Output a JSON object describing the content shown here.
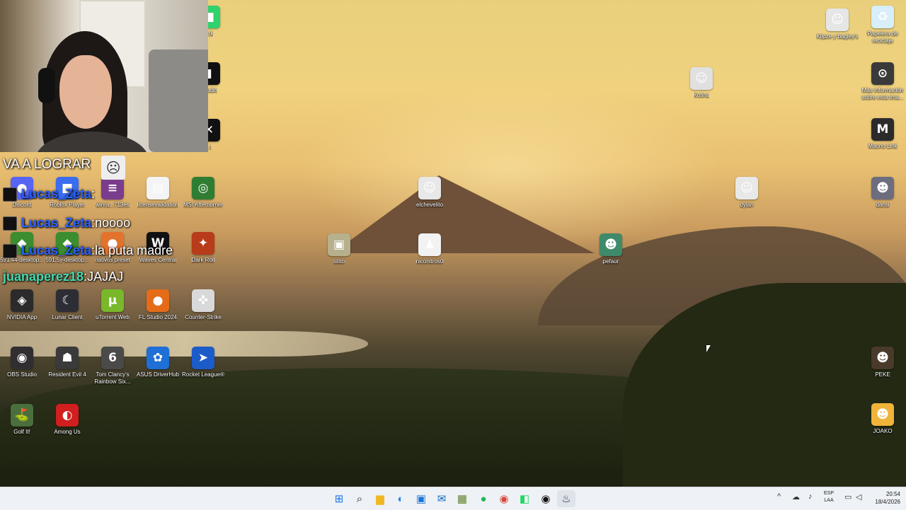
{
  "desktop": {
    "icons": [
      {
        "label": "Discord",
        "glyph": "●",
        "color": "#5865f2"
      },
      {
        "label": "Roblox Player",
        "glyph": "■",
        "color": "#3c6df0"
      },
      {
        "label": "winra...713es",
        "glyph": "≡",
        "color": "#7a3c8c"
      },
      {
        "label": "licensevalidation",
        "glyph": "▤",
        "color": "#f4f4f4"
      },
      {
        "label": "MSI Afterburner",
        "glyph": "◎",
        "color": "#2e7d32"
      },
      {
        "label": "591.44-desktop...",
        "glyph": "◆",
        "color": "#3b8d2f"
      },
      {
        "label": "591.5y-desktop...",
        "glyph": "◆",
        "color": "#3b8d2f"
      },
      {
        "label": "nativos preset",
        "glyph": "●",
        "color": "#e3732c"
      },
      {
        "label": "Waves Central",
        "glyph": "W",
        "color": "#111111"
      },
      {
        "label": "Dark Roll",
        "glyph": "✦",
        "color": "#b83b1a"
      },
      {
        "label": "NVIDIA App",
        "glyph": "◈",
        "color": "#2b2b2b"
      },
      {
        "label": "Lunar Client",
        "glyph": "☾",
        "color": "#2d2d35"
      },
      {
        "label": "uTorrent Web",
        "glyph": "µ",
        "color": "#78b82a"
      },
      {
        "label": "FL Studio 2024",
        "glyph": "●",
        "color": "#e46c19"
      },
      {
        "label": "Counter-Strike",
        "glyph": "✜",
        "color": "#d9d9d9"
      },
      {
        "label": "OBS Studio",
        "glyph": "◉",
        "color": "#302e31"
      },
      {
        "label": "Resident Evil 4",
        "glyph": "☗",
        "color": "#3a3a3a"
      },
      {
        "label": "Tom Clancy's Rainbow Six...",
        "glyph": "6",
        "color": "#4a4a4a"
      },
      {
        "label": "ASUS DriverHub",
        "glyph": "✿",
        "color": "#1e6fd6"
      },
      {
        "label": "Rocket League®",
        "glyph": "➤",
        "color": "#1c5cc9"
      },
      {
        "label": "Golf It!",
        "glyph": "⛳",
        "color": "#4a6f3c"
      },
      {
        "label": "Among Us",
        "glyph": "◐",
        "color": "#d11e1e"
      },
      {
        "label": "elchevelito",
        "glyph": "☺",
        "color": "#e8e8e8"
      },
      {
        "label": "silito",
        "glyph": "▣",
        "color": "#b7b08d"
      },
      {
        "label": "niconitros0",
        "glyph": "♟",
        "color": "#f2f2f2"
      },
      {
        "label": "pefaur",
        "glyph": "☻",
        "color": "#3f8a6a"
      },
      {
        "label": "Kotina",
        "glyph": "☺",
        "color": "#e0e0e0"
      },
      {
        "label": "dylan",
        "glyph": "☺",
        "color": "#e8e8e8"
      },
      {
        "label": "Klipze y bagley's",
        "glyph": "☺",
        "color": "#e6e6e6"
      },
      {
        "label": "Papelera de reciclaje",
        "glyph": "♻",
        "color": "#d8eef8"
      },
      {
        "label": "Más información sobre esta ima...",
        "glyph": "⊙",
        "color": "#3a3a3a"
      },
      {
        "label": "Maono Link",
        "glyph": "M",
        "color": "#2b2b2b"
      },
      {
        "label": "dansi",
        "glyph": "☻",
        "color": "#6d6d80"
      },
      {
        "label": "PEKE",
        "glyph": "☻",
        "color": "#4a3a2a"
      },
      {
        "label": "JOAKO",
        "glyph": "☻",
        "color": "#f0b43a"
      },
      {
        "label": "...tk",
        "glyph": "■",
        "color": "#2fd26c"
      },
      {
        "label": "...tudio",
        "glyph": "▮",
        "color": "#111111"
      },
      {
        "label": "...t",
        "glyph": "✕",
        "color": "#111111"
      }
    ]
  },
  "overlay": {
    "banner": "VA A LOGRAR",
    "chat": [
      {
        "user": "Lucas_Zeta",
        "sep": ": ",
        "message": "",
        "style": "user1"
      },
      {
        "user": "Lucas_Zeta",
        "sep": ": ",
        "message": "noooo",
        "style": "user1"
      },
      {
        "user": "Lucas_Zeta",
        "sep": ": ",
        "message": "la puta madre",
        "style": "user1"
      },
      {
        "user": "juanaperez18",
        "sep": ": ",
        "message": "JAJAJ",
        "style": "user2"
      }
    ]
  },
  "taskbar": {
    "apps": [
      {
        "name": "start-button",
        "glyph": "⊞",
        "color": "#1a73e8"
      },
      {
        "name": "search-button",
        "glyph": "⌕",
        "color": "#222222"
      },
      {
        "name": "file-explorer",
        "glyph": "▆",
        "color": "#f1b722"
      },
      {
        "name": "edge-browser",
        "glyph": "◐",
        "color": "#1e88e5"
      },
      {
        "name": "microsoft-store",
        "glyph": "▣",
        "color": "#1b74d8"
      },
      {
        "name": "outlook-app",
        "glyph": "✉",
        "color": "#0f6cbd"
      },
      {
        "name": "app-green",
        "glyph": "▦",
        "color": "#5f7f2a"
      },
      {
        "name": "spotify-app",
        "glyph": "●",
        "color": "#1db954"
      },
      {
        "name": "chrome-browser",
        "glyph": "◉",
        "color": "#db4437"
      },
      {
        "name": "app-green-2",
        "glyph": "◧",
        "color": "#1ed760"
      },
      {
        "name": "app-record",
        "glyph": "◉",
        "color": "#111111"
      },
      {
        "name": "steam-app",
        "glyph": "♨",
        "color": "#1b2838"
      }
    ],
    "tray": {
      "chevron": "^",
      "lang_top": "ESP",
      "lang_bottom": "LAA",
      "time": "20:54",
      "date": "18/4/2026"
    }
  }
}
